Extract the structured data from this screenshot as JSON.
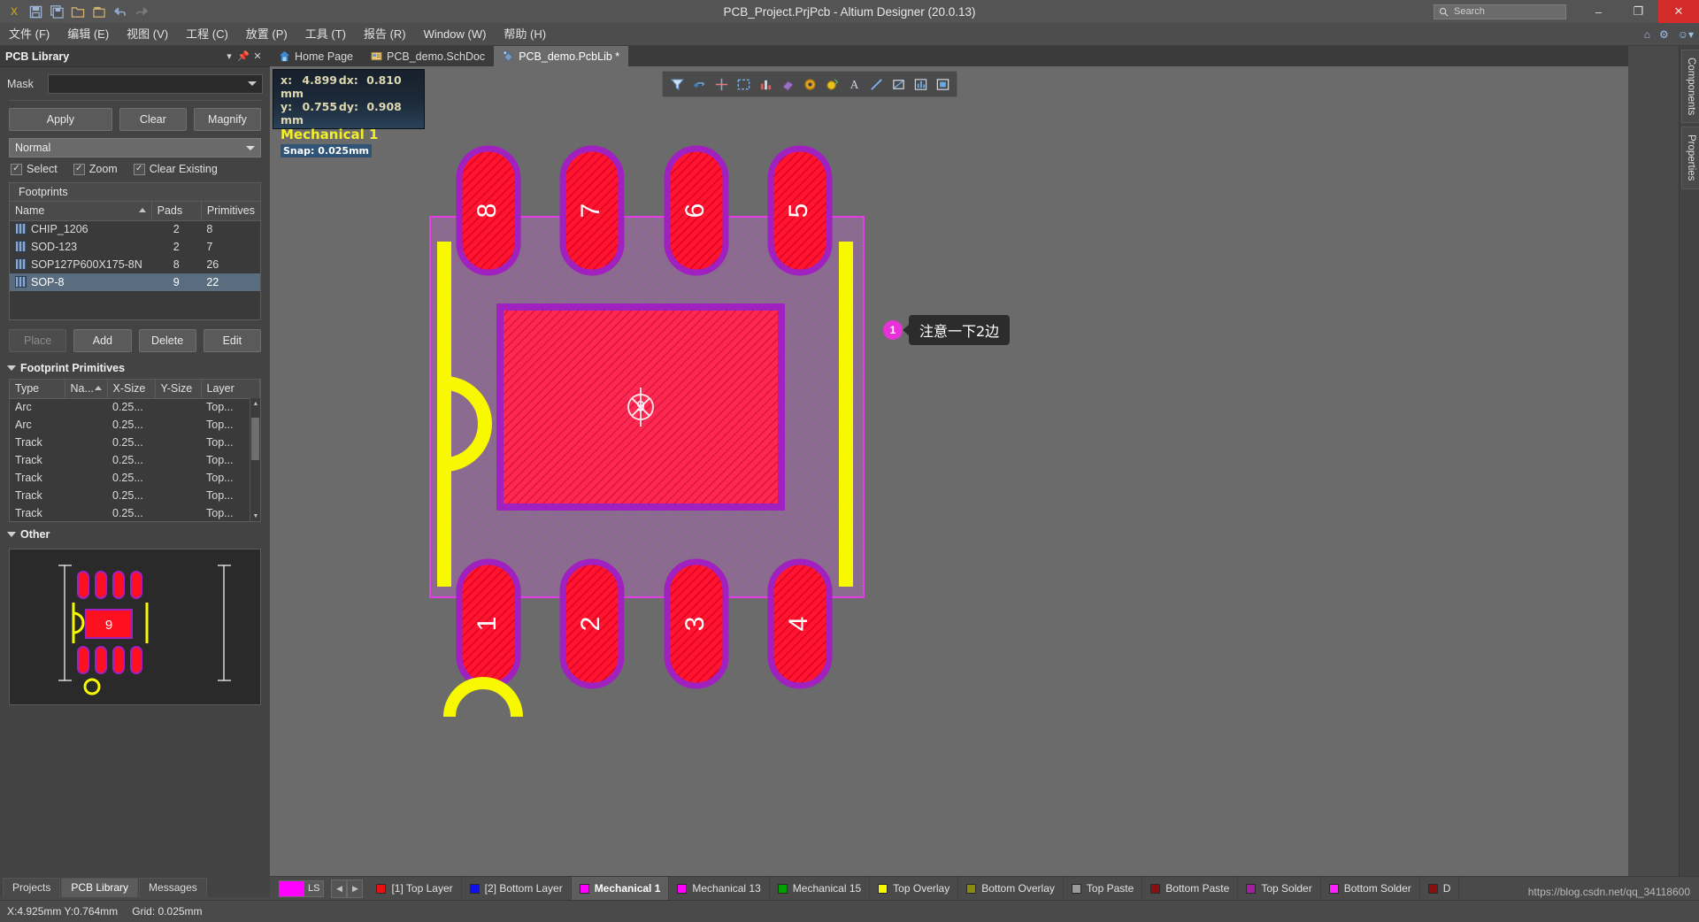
{
  "titlebar": {
    "title": "PCB_Project.PrjPcb - Altium Designer (20.0.13)",
    "search_placeholder": "Search",
    "search_icon": "search-icon",
    "quick_icons": [
      "altium-logo-icon",
      "save-icon",
      "save-all-icon",
      "open-icon",
      "open-project-icon",
      "undo-icon",
      "redo-icon"
    ],
    "minimize": "–",
    "maximize": "❐",
    "close": "✕"
  },
  "menubar": {
    "items": [
      "文件 (F)",
      "编辑 (E)",
      "视图 (V)",
      "工程 (C)",
      "放置 (P)",
      "工具 (T)",
      "报告 (R)",
      "Window (W)",
      "帮助 (H)"
    ],
    "right_icons": [
      "home-icon",
      "gear-icon",
      "user-icon"
    ]
  },
  "panel": {
    "title": "PCB Library",
    "header_icons": [
      "chevron-down-icon",
      "pin-icon",
      "close-icon"
    ],
    "mask_label": "Mask",
    "mask_value": "",
    "buttons": {
      "apply": "Apply",
      "clear": "Clear",
      "magnify": "Magnify"
    },
    "mode_value": "Normal",
    "checks": [
      {
        "label": "Select",
        "checked": true
      },
      {
        "label": "Zoom",
        "checked": true
      },
      {
        "label": "Clear Existing",
        "checked": true
      }
    ],
    "footprints": {
      "caption": "Footprints",
      "columns": [
        "Name",
        "Pads",
        "Primitives"
      ],
      "sort_column": "Name",
      "rows": [
        {
          "name": "CHIP_1206",
          "pads": "2",
          "primitives": "8",
          "selected": false
        },
        {
          "name": "SOD-123",
          "pads": "2",
          "primitives": "7",
          "selected": false
        },
        {
          "name": "SOP127P600X175-8N",
          "pads": "8",
          "primitives": "26",
          "selected": false
        },
        {
          "name": "SOP-8",
          "pads": "9",
          "primitives": "22",
          "selected": true
        }
      ]
    },
    "action_buttons": [
      {
        "label": "Place",
        "enabled": false
      },
      {
        "label": "Add",
        "enabled": true
      },
      {
        "label": "Delete",
        "enabled": true
      },
      {
        "label": "Edit",
        "enabled": true
      }
    ],
    "primitives_section": {
      "title": "Footprint Primitives",
      "columns": [
        "Type",
        "Na...",
        "X-Size",
        "Y-Size",
        "Layer"
      ],
      "sort_column": "Na...",
      "rows": [
        {
          "type": "Arc",
          "name": "",
          "xsize": "0.25...",
          "ysize": "",
          "layer": "Top..."
        },
        {
          "type": "Arc",
          "name": "",
          "xsize": "0.25...",
          "ysize": "",
          "layer": "Top..."
        },
        {
          "type": "Track",
          "name": "",
          "xsize": "0.25...",
          "ysize": "",
          "layer": "Top..."
        },
        {
          "type": "Track",
          "name": "",
          "xsize": "0.25...",
          "ysize": "",
          "layer": "Top..."
        },
        {
          "type": "Track",
          "name": "",
          "xsize": "0.25...",
          "ysize": "",
          "layer": "Top..."
        },
        {
          "type": "Track",
          "name": "",
          "xsize": "0.25...",
          "ysize": "",
          "layer": "Top..."
        },
        {
          "type": "Track",
          "name": "",
          "xsize": "0.25...",
          "ysize": "",
          "layer": "Top..."
        }
      ]
    },
    "other_section": {
      "title": "Other",
      "preview_pad_label": "9"
    }
  },
  "tabs": [
    {
      "label": "Home Page",
      "icon": "home-icon",
      "active": false
    },
    {
      "label": "PCB_demo.SchDoc",
      "icon": "schematic-icon",
      "active": false
    },
    {
      "label": "PCB_demo.PcbLib *",
      "icon": "pcblib-icon",
      "active": true
    }
  ],
  "coord_readout": {
    "x_label": "x:",
    "x_value": "4.899",
    "dx_label": "dx:",
    "dx_value": "0.810 mm",
    "y_label": "y:",
    "y_value": "0.755",
    "dy_label": "dy:",
    "dy_value": "0.908 mm",
    "layer": "Mechanical 1",
    "snap": "Snap: 0.025mm"
  },
  "canvas_toolbar": {
    "tools": [
      "filter-icon",
      "measure-icon",
      "crosshair-icon",
      "select-area-icon",
      "chart-icon",
      "eraser-icon",
      "pad-circle-icon",
      "via-icon",
      "text-icon",
      "line-icon",
      "polygon-icon",
      "graph-icon",
      "board-icon"
    ]
  },
  "pcb": {
    "pads_top": [
      "8",
      "7",
      "6",
      "5"
    ],
    "pads_bottom": [
      "1",
      "2",
      "3",
      "4"
    ],
    "center_pad": "9",
    "colors": {
      "pad_red": "#ff1020",
      "solder_purple": "#a020c0",
      "overlay_yellow": "#f8f800",
      "mechanical_magenta": "#ff00ff",
      "courtyard_fill": "#8a6d8d",
      "background": "#6b6b6b"
    }
  },
  "annotation": {
    "number": "1",
    "text": "注意一下2边"
  },
  "right_dock": {
    "tabs": [
      "Components",
      "Properties"
    ]
  },
  "bottom_panel_tabs": [
    {
      "label": "Projects",
      "active": false
    },
    {
      "label": "PCB Library",
      "active": true
    },
    {
      "label": "Messages",
      "active": false
    }
  ],
  "layer_bar": {
    "ls_label": "LS",
    "ls_color": "#ff00ff",
    "prev_icon": "chevron-left-icon",
    "next_icon": "chevron-right-icon",
    "layers": [
      {
        "label": "[1] Top Layer",
        "color": "#e81010",
        "active": false
      },
      {
        "label": "[2] Bottom Layer",
        "color": "#1010e8",
        "active": false
      },
      {
        "label": "Mechanical 1",
        "color": "#ff00ff",
        "active": true
      },
      {
        "label": "Mechanical 13",
        "color": "#ff00ff",
        "active": false
      },
      {
        "label": "Mechanical 15",
        "color": "#00a000",
        "active": false
      },
      {
        "label": "Top Overlay",
        "color": "#f8f800",
        "active": false
      },
      {
        "label": "Bottom Overlay",
        "color": "#8a8a10",
        "active": false
      },
      {
        "label": "Top Paste",
        "color": "#9a9a9a",
        "active": false
      },
      {
        "label": "Bottom Paste",
        "color": "#8a1010",
        "active": false
      },
      {
        "label": "Top Solder",
        "color": "#a020a0",
        "active": false
      },
      {
        "label": "Bottom Solder",
        "color": "#ff20ff",
        "active": false
      },
      {
        "label": "D",
        "color": "#8a1010",
        "active": false
      }
    ]
  },
  "statusbar": {
    "coords": "X:4.925mm Y:0.764mm",
    "grid": "Grid: 0.025mm",
    "watermark": "https://blog.csdn.net/qq_34118600"
  }
}
